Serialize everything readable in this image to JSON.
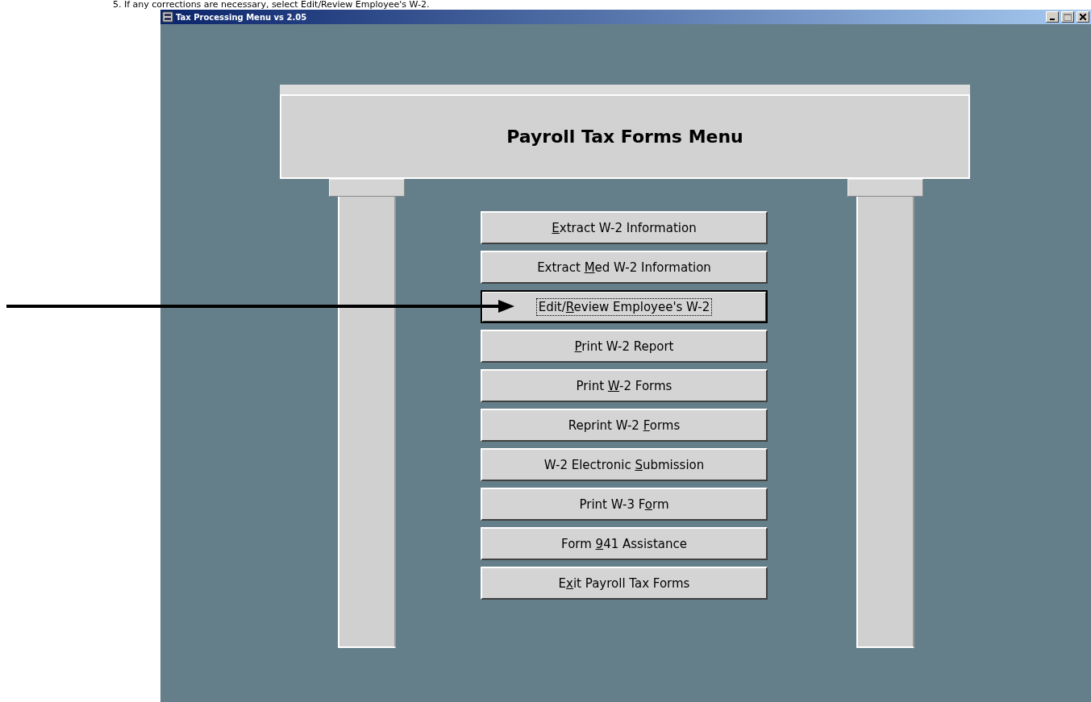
{
  "instruction": "5. If any corrections are necessary, select Edit/Review Employee's W-2.",
  "window": {
    "title": "Tax Processing Menu vs 2.05"
  },
  "menu": {
    "title": "Payroll Tax Forms Menu",
    "buttons": [
      {
        "key": "E",
        "post": "xtract W-2 Information",
        "focused": false
      },
      {
        "pre": "Extract ",
        "key": "M",
        "post": "ed W-2 Information",
        "focused": false
      },
      {
        "pre": "Edit/",
        "key": "R",
        "post": "eview Employee's W-2",
        "focused": true
      },
      {
        "key": "P",
        "post": "rint W-2 Report",
        "focused": false
      },
      {
        "pre": "Print ",
        "key": "W",
        "post": "-2 Forms",
        "focused": false
      },
      {
        "pre": "Reprint W-2 ",
        "key": "F",
        "post": "orms",
        "focused": false
      },
      {
        "pre": "W-2 Electronic ",
        "key": "S",
        "post": "ubmission",
        "focused": false
      },
      {
        "pre": "Print W-3 F",
        "key": "o",
        "post": "rm",
        "focused": false
      },
      {
        "pre": "Form ",
        "key": "9",
        "post": "41 Assistance",
        "focused": false
      },
      {
        "pre": "E",
        "key": "x",
        "post": "it Payroll Tax Forms",
        "focused": false
      }
    ]
  }
}
